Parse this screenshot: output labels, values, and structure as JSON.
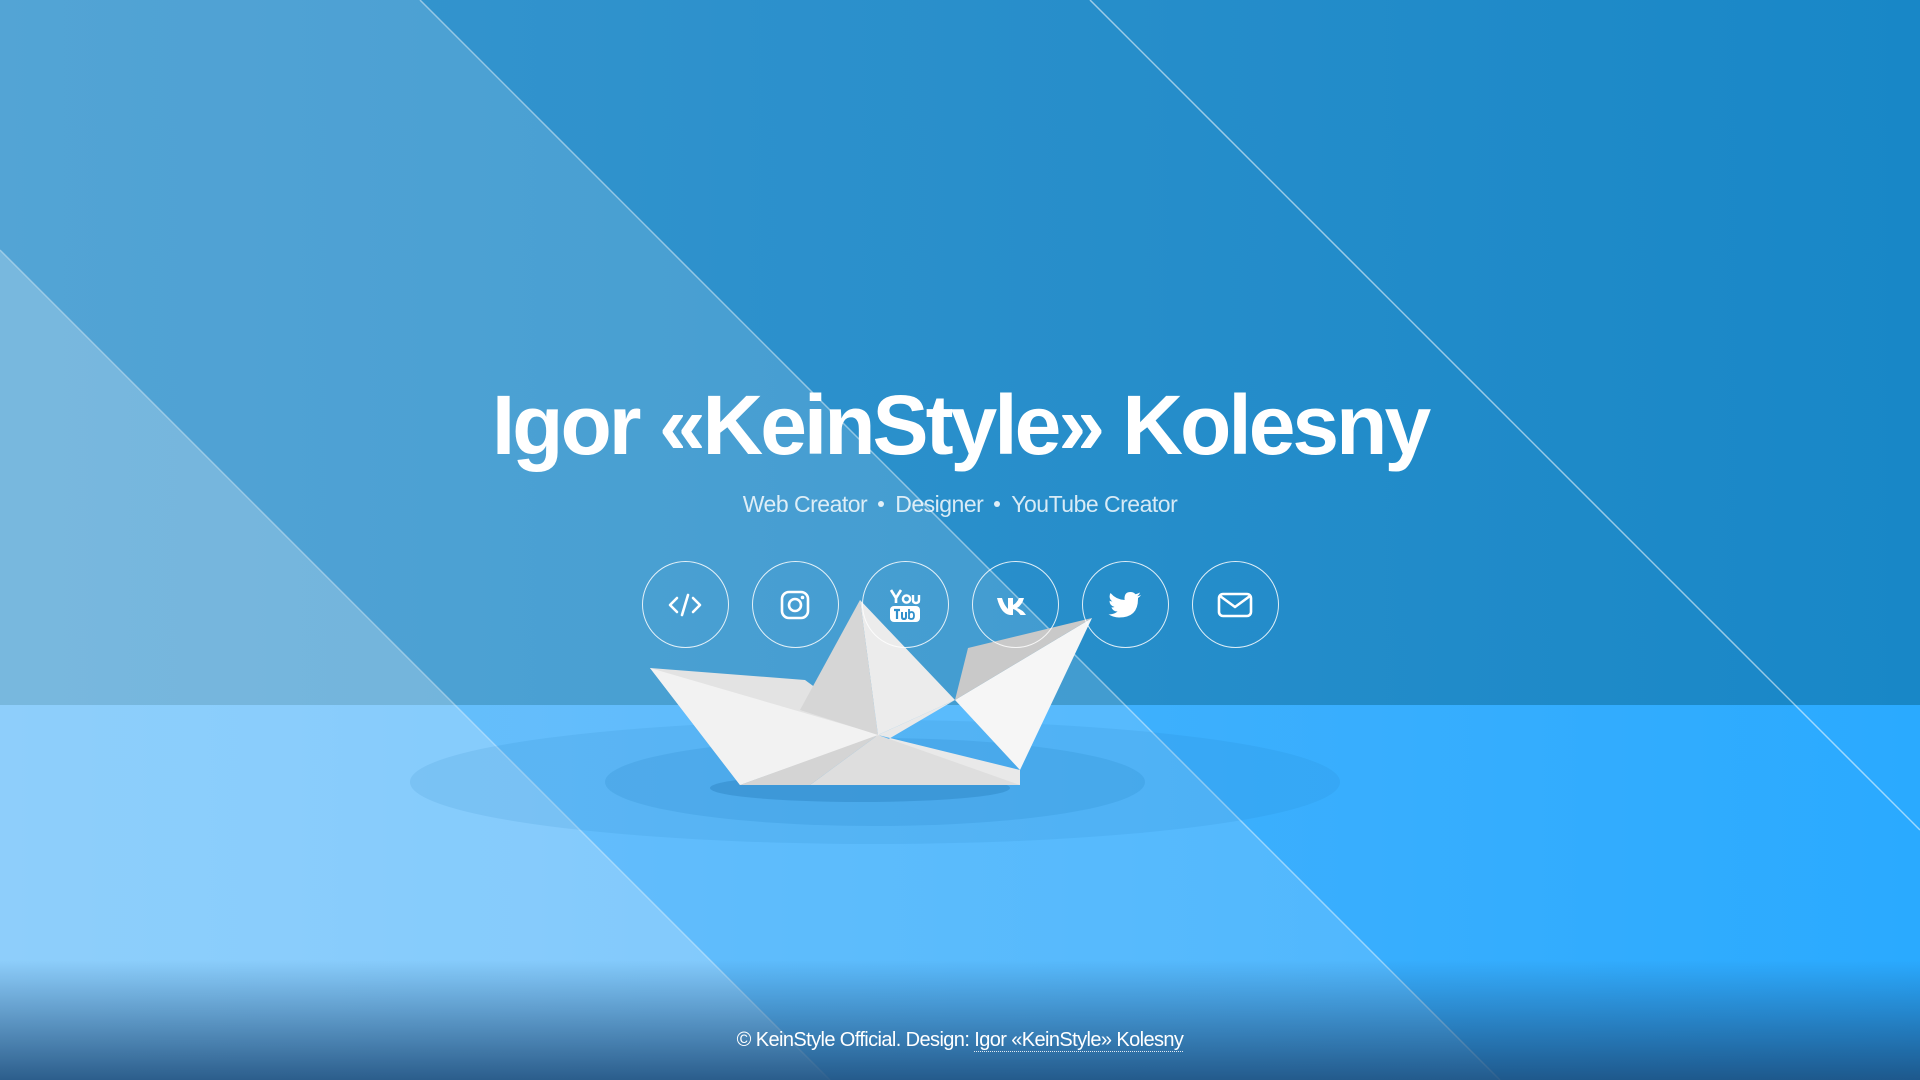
{
  "header": {
    "title": "Igor «KeinStyle» Kolesny",
    "roles": [
      "Web Creator",
      "Designer",
      "YouTube Creator"
    ]
  },
  "socials": [
    {
      "icon": "code-icon"
    },
    {
      "icon": "instagram-icon"
    },
    {
      "icon": "youtube-icon"
    },
    {
      "icon": "vk-icon"
    },
    {
      "icon": "twitter-icon"
    },
    {
      "icon": "mail-icon"
    }
  ],
  "footer": {
    "copyright": "© KeinStyle Official. Design: ",
    "author_link": "Igor «KeinStyle» Kolesny"
  },
  "colors": {
    "sky_dark": "#1a88c8",
    "sky_light": "#2f8fcb",
    "water": "#2baaff",
    "water_light": "#7dc9fb",
    "boat": "#f5f5f5",
    "text": "#ffffff"
  }
}
